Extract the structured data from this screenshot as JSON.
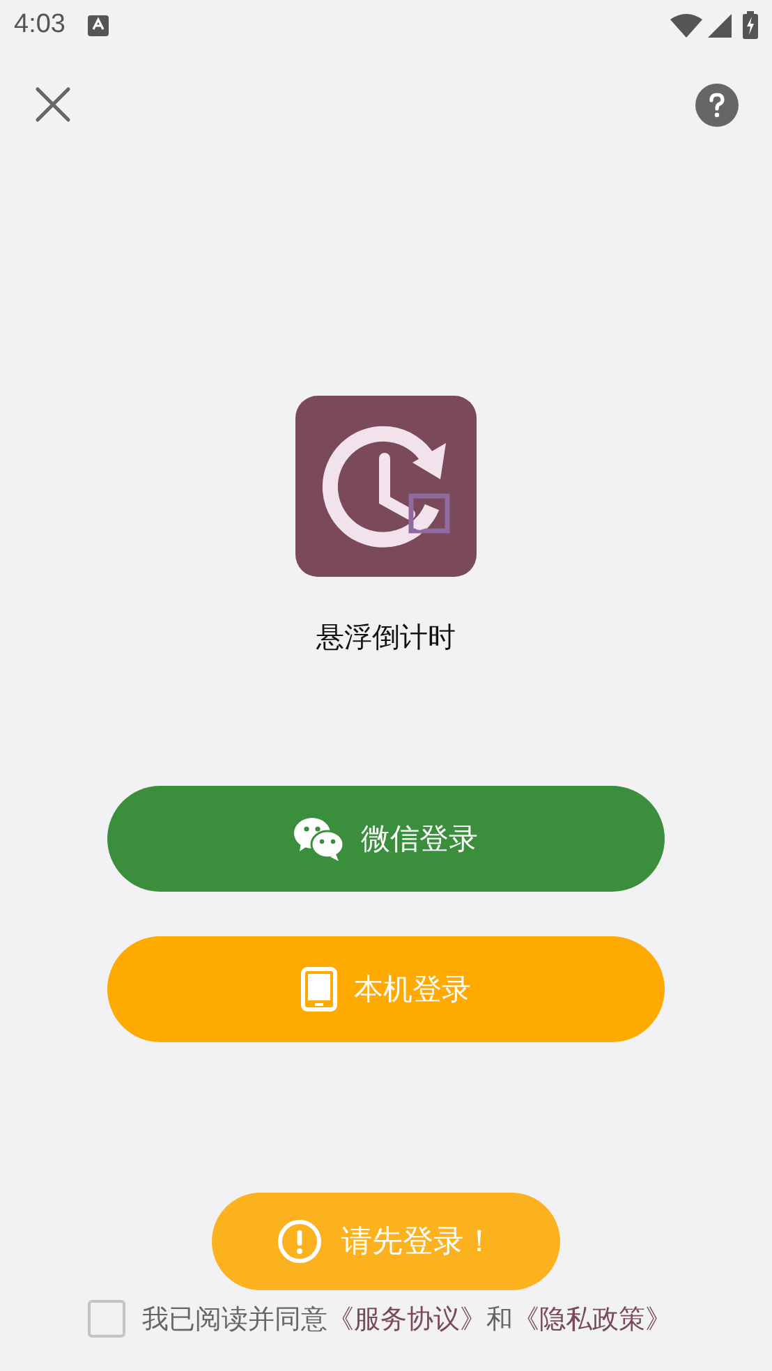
{
  "status_bar": {
    "time": "4:03"
  },
  "app": {
    "name": "悬浮倒计时"
  },
  "login_buttons": [
    {
      "kind": "wechat",
      "label": "微信登录"
    },
    {
      "kind": "phone",
      "label": "本机登录"
    }
  ],
  "agreement": {
    "checked": false,
    "parts": [
      {
        "kind": "text",
        "text": "我已阅读并同意"
      },
      {
        "kind": "link",
        "text": "《服务协议》"
      },
      {
        "kind": "text",
        "text": "和"
      },
      {
        "kind": "link",
        "text": "《隐私政策》"
      }
    ]
  },
  "toast": {
    "text": "请先登录！"
  }
}
